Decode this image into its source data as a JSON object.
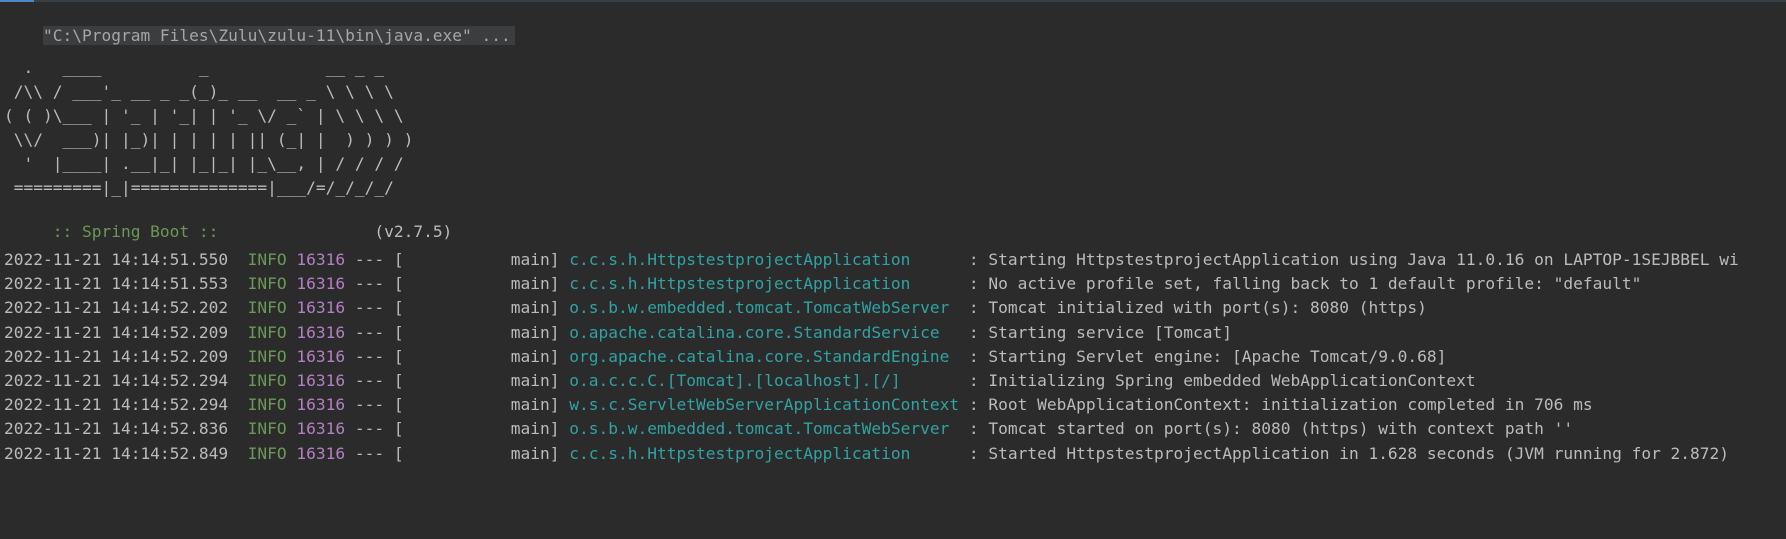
{
  "console": {
    "command": "\"C:\\Program Files\\Zulu\\zulu-11\\bin\\java.exe\" ...",
    "banner": [
      "  .   ____          _            __ _ _",
      " /\\\\ / ___'_ __ _ _(_)_ __  __ _ \\ \\ \\ \\",
      "( ( )\\___ | '_ | '_| | '_ \\/ _` | \\ \\ \\ \\",
      " \\\\/  ___)| |_)| | | | | || (_| |  ) ) ) )",
      "  '  |____| .__|_| |_|_| |_\\__, | / / / /",
      " =========|_|==============|___/=/_/_/_/"
    ],
    "spring_label": " :: Spring Boot :: ",
    "spring_version": "               (v2.7.5)",
    "log_lines": [
      {
        "timestamp": "2022-11-21 14:14:51.550",
        "level": "INFO",
        "pid": "16316",
        "thread": "--- [           main]",
        "logger": "c.c.s.h.HttpstestprojectApplication     ",
        "message": " : Starting HttpstestprojectApplication using Java 11.0.16 on LAPTOP-1SEJBBEL wi"
      },
      {
        "timestamp": "2022-11-21 14:14:51.553",
        "level": "INFO",
        "pid": "16316",
        "thread": "--- [           main]",
        "logger": "c.c.s.h.HttpstestprojectApplication     ",
        "message": " : No active profile set, falling back to 1 default profile: \"default\""
      },
      {
        "timestamp": "2022-11-21 14:14:52.202",
        "level": "INFO",
        "pid": "16316",
        "thread": "--- [           main]",
        "logger": "o.s.b.w.embedded.tomcat.TomcatWebServer ",
        "message": " : Tomcat initialized with port(s): 8080 (https)"
      },
      {
        "timestamp": "2022-11-21 14:14:52.209",
        "level": "INFO",
        "pid": "16316",
        "thread": "--- [           main]",
        "logger": "o.apache.catalina.core.StandardService  ",
        "message": " : Starting service [Tomcat]"
      },
      {
        "timestamp": "2022-11-21 14:14:52.209",
        "level": "INFO",
        "pid": "16316",
        "thread": "--- [           main]",
        "logger": "org.apache.catalina.core.StandardEngine ",
        "message": " : Starting Servlet engine: [Apache Tomcat/9.0.68]"
      },
      {
        "timestamp": "2022-11-21 14:14:52.294",
        "level": "INFO",
        "pid": "16316",
        "thread": "--- [           main]",
        "logger": "o.a.c.c.C.[Tomcat].[localhost].[/]      ",
        "message": " : Initializing Spring embedded WebApplicationContext"
      },
      {
        "timestamp": "2022-11-21 14:14:52.294",
        "level": "INFO",
        "pid": "16316",
        "thread": "--- [           main]",
        "logger": "w.s.c.ServletWebServerApplicationContext",
        "message": " : Root WebApplicationContext: initialization completed in 706 ms"
      },
      {
        "timestamp": "2022-11-21 14:14:52.836",
        "level": "INFO",
        "pid": "16316",
        "thread": "--- [           main]",
        "logger": "o.s.b.w.embedded.tomcat.TomcatWebServer ",
        "message": " : Tomcat started on port(s): 8080 (https) with context path ''"
      },
      {
        "timestamp": "2022-11-21 14:14:52.849",
        "level": "INFO",
        "pid": "16316",
        "thread": "--- [           main]",
        "logger": "c.c.s.h.HttpstestprojectApplication     ",
        "message": " : Started HttpstestprojectApplication in 1.628 seconds (JVM running for 2.872)"
      }
    ]
  },
  "colors": {
    "background": "#2b2b2b",
    "text": "#bbbbbb",
    "info": "#6a9955",
    "pid": "#b37fc3",
    "logger": "#2fa3a3"
  }
}
